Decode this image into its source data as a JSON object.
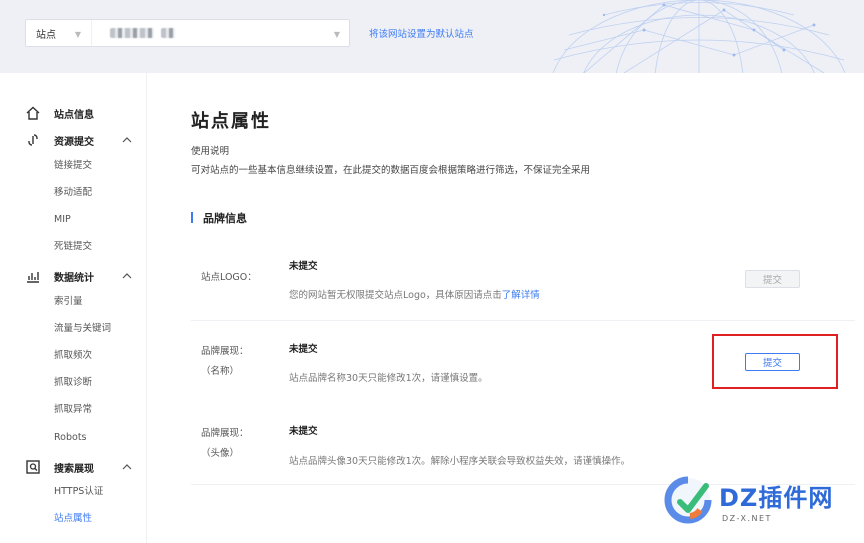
{
  "header": {
    "site_type": "站点",
    "site_domain_visible": "",
    "set_default_link": "将该网站设置为默认站点"
  },
  "sidebar": {
    "site_info": "站点信息",
    "resource_submit": {
      "label": "资源提交",
      "items": [
        "链接提交",
        "移动适配",
        "MIP",
        "死链提交"
      ]
    },
    "data_stats": {
      "label": "数据统计",
      "items": [
        "索引量",
        "流量与关键词",
        "抓取频次",
        "抓取诊断",
        "抓取异常",
        "Robots"
      ]
    },
    "search_display": {
      "label": "搜索展现",
      "items": [
        "HTTPS认证",
        "站点属性"
      ]
    },
    "active_item": "站点属性"
  },
  "main": {
    "title": "站点属性",
    "usage_title": "使用说明",
    "usage_desc": "可对站点的一些基本信息继续设置，在此提交的数据百度会根据策略进行筛选，不保证完全采用",
    "section_title": "品牌信息",
    "rows": [
      {
        "label": "站点LOGO：",
        "status": "未提交",
        "note": "您的网站暂无权限提交站点Logo，具体原因请点击",
        "note_link": "了解详情",
        "button": "提交",
        "button_state": "disabled"
      },
      {
        "label_line1": "品牌展现：",
        "label_line2": "（名称）",
        "status": "未提交",
        "note": "站点品牌名称30天只能修改1次，请谨慎设置。",
        "button": "提交",
        "button_state": "enabled",
        "highlighted": true
      },
      {
        "label_line1": "品牌展现：",
        "label_line2": "（头像）",
        "status": "未提交",
        "note": "站点品牌头像30天只能修改1次。解除小程序关联会导致权益失效，请谨慎操作。"
      }
    ]
  },
  "watermark": {
    "text": "DZ插件网",
    "sub": "DZ-X.NET"
  },
  "colors": {
    "accent": "#3e7bf2",
    "highlight_border": "#e02020",
    "header_bg": "#eef0f6"
  }
}
